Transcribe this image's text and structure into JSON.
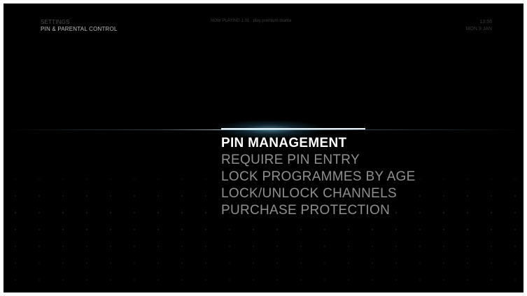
{
  "header": {
    "breadcrumb_parent": "SETTINGS",
    "breadcrumb_current": "PIN & PARENTAL CONTROL",
    "now_playing": "NOW PLAYING 1.01 · play premium drama",
    "time": "13:56",
    "date": "MON 9 JAN"
  },
  "menu": {
    "selected_index": 0,
    "items": [
      {
        "label": "PIN MANAGEMENT"
      },
      {
        "label": "REQUIRE PIN ENTRY"
      },
      {
        "label": "LOCK PROGRAMMES BY AGE"
      },
      {
        "label": "LOCK/UNLOCK CHANNELS"
      },
      {
        "label": "PURCHASE PROTECTION"
      }
    ]
  },
  "colors": {
    "background": "#000000",
    "selected_text": "#ffffff",
    "menu_text": "#8f8f8f",
    "accent_glow": "#7fc8e6"
  }
}
